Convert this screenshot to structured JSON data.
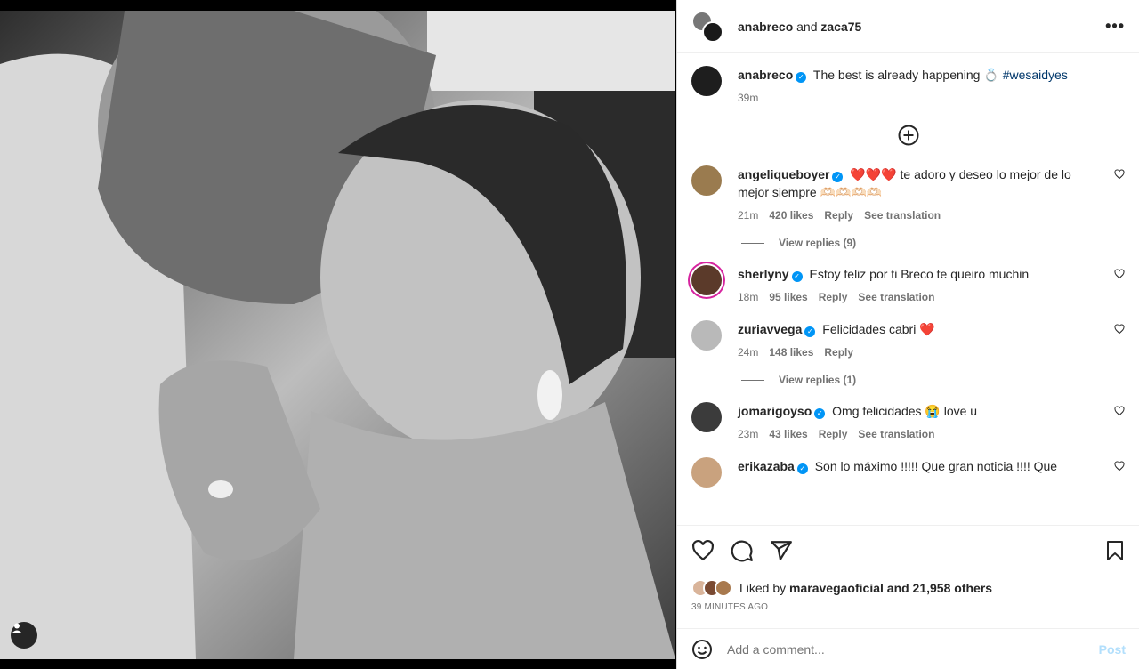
{
  "photo": {
    "tag_icon": "user-tag-icon"
  },
  "header": {
    "user1": "anabreco",
    "joiner": "and",
    "user2": "zaca75",
    "more_label": "•••"
  },
  "caption": {
    "username": "anabreco",
    "text": "The best is already happening 💍",
    "hashtag": "#wesaidyes",
    "time": "39m"
  },
  "comments": [
    {
      "username": "angeliqueboyer",
      "text": "❤️❤️❤️ te adoro y deseo lo mejor de lo mejor siempre 🫶🏻🫶🏻🫶🏻🫶🏻",
      "time": "21m",
      "likes": "420 likes",
      "reply": "Reply",
      "translate": "See translation",
      "view_replies": "View replies (9)",
      "avatar_color": "#9a7b4f"
    },
    {
      "username": "sherlyny",
      "text": "Estoy feliz por ti Breco te queiro muchin",
      "time": "18m",
      "likes": "95 likes",
      "reply": "Reply",
      "translate": "See translation",
      "avatar_color": "#5b3a2a"
    },
    {
      "username": "zuriavvega",
      "text": "Felicidades cabri ❤️",
      "time": "24m",
      "likes": "148 likes",
      "reply": "Reply",
      "view_replies": "View replies (1)",
      "avatar_color": "#b9b9b9"
    },
    {
      "username": "jomarigoyso",
      "text": "Omg felicidades 😭 love u",
      "time": "23m",
      "likes": "43 likes",
      "reply": "Reply",
      "translate": "See translation",
      "avatar_color": "#3b3b3b"
    },
    {
      "username": "erikazaba",
      "text": "Son lo máximo !!!!! Que gran noticia !!!! Que",
      "avatar_color": "#c9a27e"
    }
  ],
  "likes": {
    "prefix": "Liked by",
    "user": "maravegaoficial",
    "suffix": "and 21,958 others"
  },
  "time_ago": "39 MINUTES AGO",
  "add_comment": {
    "placeholder": "Add a comment...",
    "post_label": "Post"
  },
  "colors": {
    "verified": "#0095f6",
    "heart_red": "#e0245e",
    "link": "#00376b"
  }
}
